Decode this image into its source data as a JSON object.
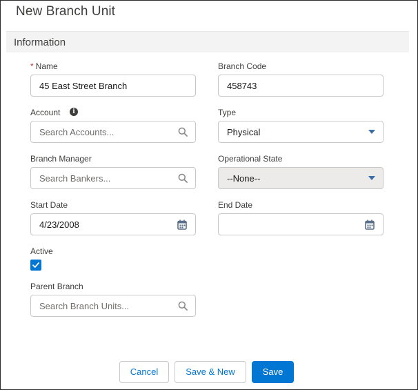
{
  "dialog": {
    "title": "New Branch Unit"
  },
  "section": {
    "title": "Information"
  },
  "fields": {
    "name": {
      "label": "Name",
      "required_mark": "*",
      "value": "45 East Street Branch"
    },
    "branch_code": {
      "label": "Branch Code",
      "value": "458743"
    },
    "account": {
      "label": "Account",
      "placeholder": "Search Accounts...",
      "info_icon": "info-icon"
    },
    "type": {
      "label": "Type",
      "value": "Physical",
      "icon": "chevron-down-icon"
    },
    "branch_manager": {
      "label": "Branch Manager",
      "placeholder": "Search Bankers..."
    },
    "operational_state": {
      "label": "Operational State",
      "value": "--None--",
      "icon": "chevron-down-icon"
    },
    "start_date": {
      "label": "Start Date",
      "value": "4/23/2008",
      "icon": "calendar-icon"
    },
    "end_date": {
      "label": "End Date",
      "value": "",
      "icon": "calendar-icon"
    },
    "active": {
      "label": "Active",
      "checked": true
    },
    "parent_branch": {
      "label": "Parent Branch",
      "placeholder": "Search Branch Units..."
    }
  },
  "buttons": {
    "cancel": "Cancel",
    "save_new": "Save & New",
    "save": "Save"
  },
  "colors": {
    "brand": "#0176d3",
    "required": "#c23934",
    "caret": "#3e6ea8",
    "disabled_bg": "#ecebea"
  }
}
